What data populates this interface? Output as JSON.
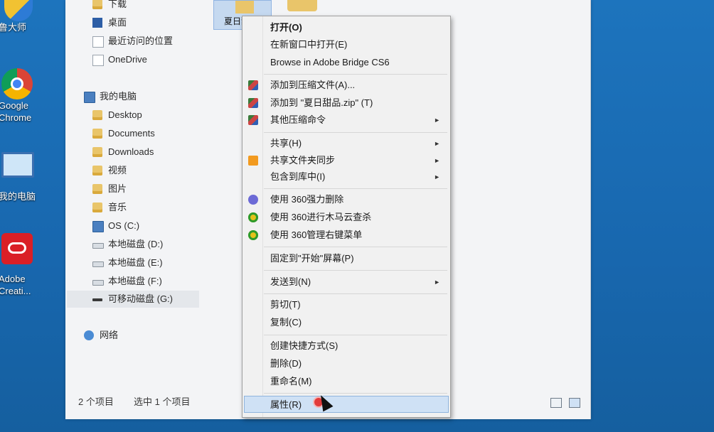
{
  "desktop": {
    "icons": [
      {
        "label": "鲁大师"
      },
      {
        "label": "Google\nChrome"
      },
      {
        "label": "我的电脑"
      },
      {
        "label": "Adobe\nCreati..."
      }
    ]
  },
  "nav": {
    "items": [
      {
        "label": "下载"
      },
      {
        "label": "桌面"
      },
      {
        "label": "最近访问的位置"
      },
      {
        "label": "OneDrive"
      },
      {
        "label": "我的电脑"
      },
      {
        "label": "Desktop"
      },
      {
        "label": "Documents"
      },
      {
        "label": "Downloads"
      },
      {
        "label": "视频"
      },
      {
        "label": "图片"
      },
      {
        "label": "音乐"
      },
      {
        "label": "OS (C:)"
      },
      {
        "label": "本地磁盘 (D:)"
      },
      {
        "label": "本地磁盘 (E:)"
      },
      {
        "label": "本地磁盘 (F:)"
      },
      {
        "label": "可移动磁盘 (G:)"
      },
      {
        "label": "网络"
      }
    ]
  },
  "content": {
    "selected_file": "夏日甜品"
  },
  "status": {
    "count": "2 个项目",
    "selected": "选中 1 个项目"
  },
  "context_menu": {
    "items": [
      {
        "label": "打开(O)"
      },
      {
        "label": "在新窗口中打开(E)"
      },
      {
        "label": "Browse in Adobe Bridge CS6"
      },
      {
        "label": "添加到压缩文件(A)..."
      },
      {
        "label": "添加到 \"夏日甜品.zip\" (T)"
      },
      {
        "label": "其他压缩命令"
      },
      {
        "label": "共享(H)"
      },
      {
        "label": "共享文件夹同步"
      },
      {
        "label": "包含到库中(I)"
      },
      {
        "label": "使用 360强力删除"
      },
      {
        "label": "使用 360进行木马云查杀"
      },
      {
        "label": "使用 360管理右键菜单"
      },
      {
        "label": "固定到\"开始\"屏幕(P)"
      },
      {
        "label": "发送到(N)"
      },
      {
        "label": "剪切(T)"
      },
      {
        "label": "复制(C)"
      },
      {
        "label": "创建快捷方式(S)"
      },
      {
        "label": "删除(D)"
      },
      {
        "label": "重命名(M)"
      },
      {
        "label": "属性(R)"
      }
    ],
    "submenu_arrow": "►"
  }
}
